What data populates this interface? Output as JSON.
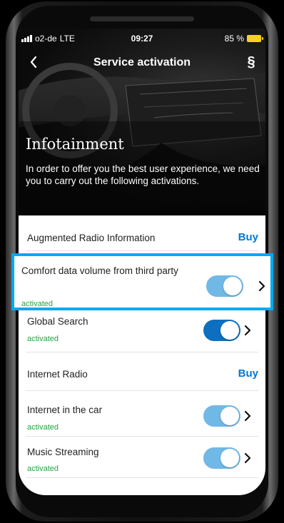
{
  "status_bar": {
    "carrier": "o2-de",
    "network": "LTE",
    "time": "09:27",
    "battery": "85 %"
  },
  "nav": {
    "title": "Service activation",
    "back_icon": "chevron-left-icon",
    "legal_label": "§"
  },
  "hero": {
    "title": "Infotainment",
    "text": "In order to offer you the best user experience, we need you to carry out the following activations."
  },
  "services": [
    {
      "label": "Augmented Radio Information",
      "status": "",
      "action": "Buy",
      "toggle_on": false
    },
    {
      "label": "Comfort data volume from third party",
      "status": "activated",
      "action": "toggle",
      "toggle_on": true
    },
    {
      "label": "Global Search",
      "status": "activated",
      "action": "toggle",
      "toggle_on": true
    },
    {
      "label": "Internet Radio",
      "status": "",
      "action": "Buy",
      "toggle_on": false
    },
    {
      "label": "Internet in the car",
      "status": "activated",
      "action": "toggle",
      "toggle_on": true
    },
    {
      "label": "Music Streaming",
      "status": "activated",
      "action": "toggle",
      "toggle_on": true
    }
  ],
  "colors": {
    "accent_blue": "#0078d6",
    "toggle_light": "#70b8e6",
    "toggle_dark": "#0d6fbf",
    "status_green": "#20a542",
    "highlight_border": "#00a9f0"
  }
}
